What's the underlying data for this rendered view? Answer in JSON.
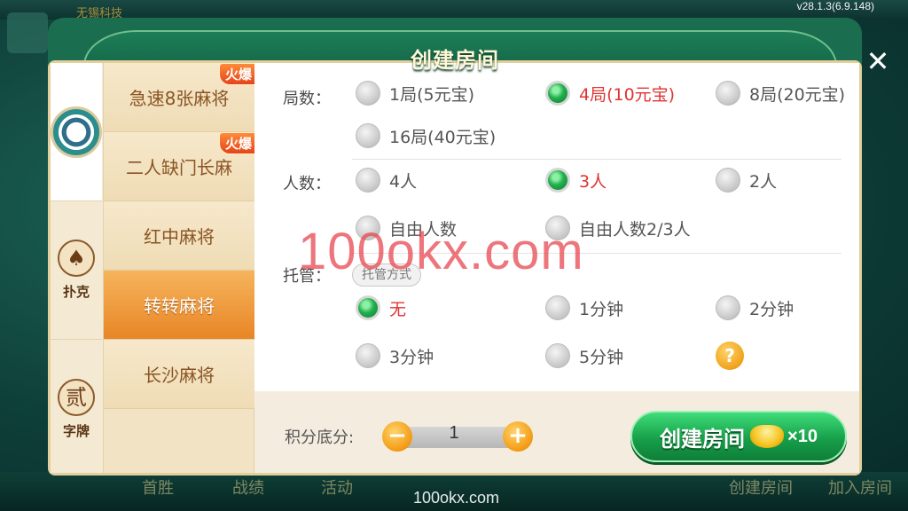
{
  "version": "v28.1.3(6.9.148)",
  "background": {
    "top_title": "无锡科技",
    "bottom_items": [
      "首胜",
      "战绩",
      "活动",
      "创建房间",
      "加入房间"
    ],
    "watermark_bottom": "100okx.com"
  },
  "dialog": {
    "title": "创建房间",
    "close_icon": "close-icon"
  },
  "rail": {
    "items": [
      {
        "icon": "mahjong-icon",
        "label": ""
      },
      {
        "icon": "spade-icon",
        "glyph": "♠",
        "label": "扑克"
      },
      {
        "icon": "tile-icon",
        "glyph": "贰",
        "label": "字牌"
      }
    ]
  },
  "games": [
    {
      "name": "急速8张麻将",
      "badge": "火爆"
    },
    {
      "name": "二人缺门长麻",
      "badge": "火爆"
    },
    {
      "name": "红中麻将",
      "badge": ""
    },
    {
      "name": "转转麻将",
      "badge": "",
      "active": true
    },
    {
      "name": "长沙麻将",
      "badge": ""
    }
  ],
  "options": {
    "rounds": {
      "label": "局数：",
      "choices": [
        "1局(5元宝)",
        "4局(10元宝)",
        "8局(20元宝)",
        "16局(40元宝)"
      ],
      "selected": "4局(10元宝)"
    },
    "players": {
      "label": "人数：",
      "choices": [
        "4人",
        "3人",
        "2人",
        "自由人数",
        "自由人数2/3人"
      ],
      "selected": "3人"
    },
    "trustee": {
      "label": "托管：",
      "tag": "托管方式",
      "choices": [
        "无",
        "1分钟",
        "2分钟",
        "3分钟",
        "5分钟"
      ],
      "selected": "无",
      "help_glyph": "?"
    }
  },
  "footer": {
    "score_label": "积分底分:",
    "score_value": "1",
    "minus": "−",
    "plus": "+",
    "create_label": "创建房间",
    "cost": "×10"
  },
  "watermark": "100okx.com",
  "colors": {
    "accent_green": "#17a04a",
    "selected_text": "#e03333",
    "active_game": "#e88626",
    "header_green": "#1b6d4f"
  }
}
